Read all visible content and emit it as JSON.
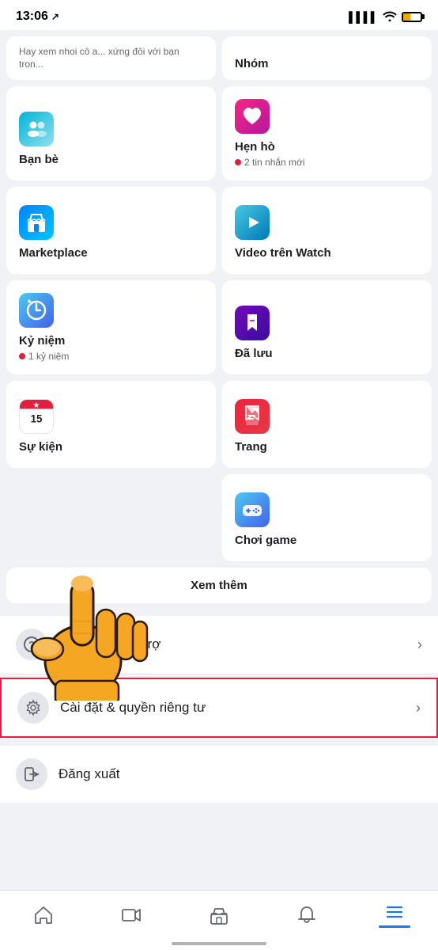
{
  "statusBar": {
    "time": "13:06",
    "locationIcon": "↗"
  },
  "topPartial": {
    "leftText": "Hay xem nhoi cô a... xứng đôi với bạn tron...",
    "rightLabel": "Nhóm"
  },
  "menuItems": [
    {
      "id": "friends",
      "label": "Bạn bè",
      "iconType": "friends",
      "badge": null
    },
    {
      "id": "dating",
      "label": "Hẹn hò",
      "iconType": "dating",
      "badge": "2 tin nhắn mới"
    },
    {
      "id": "marketplace",
      "label": "Marketplace",
      "iconType": "marketplace",
      "badge": null
    },
    {
      "id": "watch",
      "label": "Video trên Watch",
      "iconType": "watch",
      "badge": null
    },
    {
      "id": "memories",
      "label": "Kỷ niệm",
      "iconType": "memories",
      "badge": "1 kỷ niệm"
    },
    {
      "id": "saved",
      "label": "Đã lưu",
      "iconType": "saved",
      "badge": null
    },
    {
      "id": "events",
      "label": "Sự kiện",
      "iconType": "events",
      "badge": null
    },
    {
      "id": "pages",
      "label": "Trang",
      "iconType": "pages",
      "badge": null
    },
    {
      "id": "gaming",
      "label": "Chơi game",
      "iconType": "gaming",
      "badge": null,
      "singleColumn": true
    }
  ],
  "seeMore": {
    "label": "Xem thêm"
  },
  "sections": [
    {
      "id": "help",
      "icon": "❓",
      "label": "Trợ giúp & hỗ trợ",
      "highlighted": false
    },
    {
      "id": "settings",
      "icon": "⚙️",
      "label": "Cài đặt & quyền riêng tư",
      "highlighted": true
    }
  ],
  "signOut": {
    "icon": "🚪",
    "label": "Đăng xuất"
  },
  "bottomNav": [
    {
      "id": "home",
      "label": "home",
      "active": false
    },
    {
      "id": "video",
      "label": "video",
      "active": false
    },
    {
      "id": "marketplace",
      "label": "marketplace",
      "active": false
    },
    {
      "id": "notifications",
      "label": "notifications",
      "active": false
    },
    {
      "id": "menu",
      "label": "menu",
      "active": true
    }
  ]
}
